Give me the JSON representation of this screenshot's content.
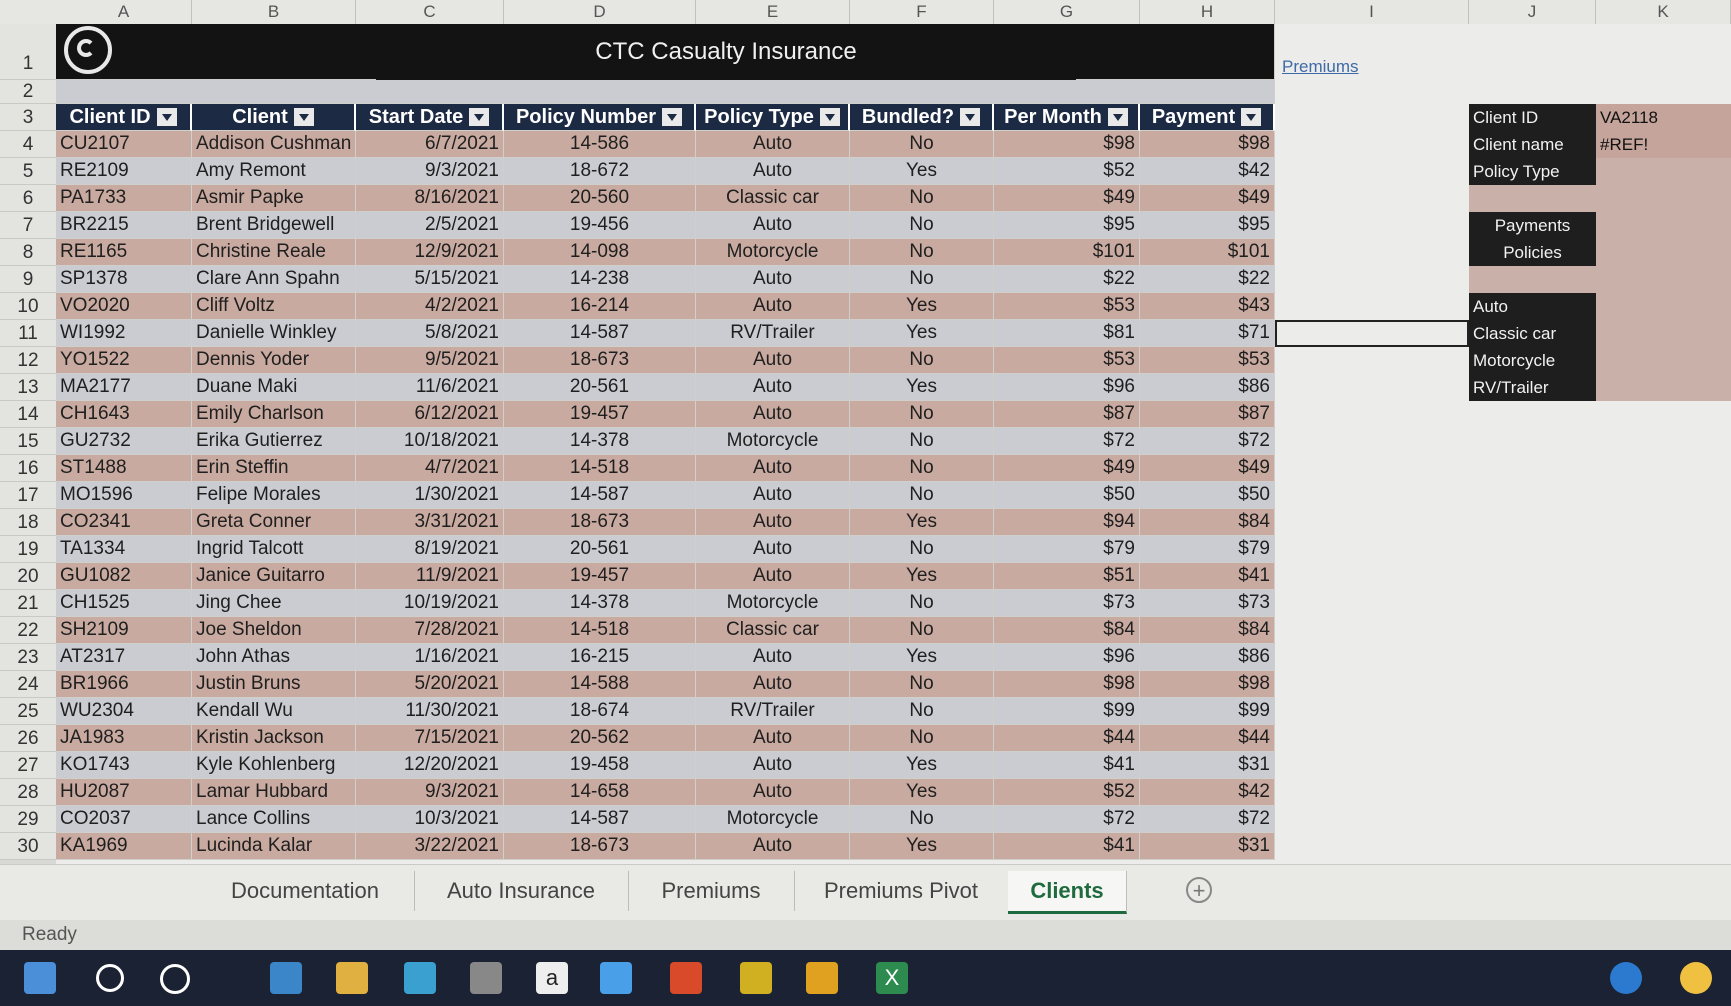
{
  "columns": [
    "A",
    "B",
    "C",
    "D",
    "E",
    "F",
    "G",
    "H",
    "I",
    "J",
    "K"
  ],
  "row_numbers": [
    "1",
    "2",
    "3",
    "4",
    "5",
    "6",
    "7",
    "8",
    "9",
    "10",
    "11",
    "12",
    "13",
    "14",
    "15",
    "16",
    "17",
    "18",
    "19",
    "20",
    "21",
    "22",
    "23",
    "24",
    "25",
    "26",
    "27",
    "28",
    "29",
    "30"
  ],
  "title": "CTC Casualty Insurance",
  "premiums_link": "Premiums",
  "headers": [
    "Client ID",
    "Client",
    "Start Date",
    "Policy Number",
    "Policy Type",
    "Bundled?",
    "Per Month",
    "Payment"
  ],
  "rows": [
    [
      "CU2107",
      "Addison Cushman",
      "6/7/2021",
      "14-586",
      "Auto",
      "No",
      "$98",
      "$98"
    ],
    [
      "RE2109",
      "Amy Remont",
      "9/3/2021",
      "18-672",
      "Auto",
      "Yes",
      "$52",
      "$42"
    ],
    [
      "PA1733",
      "Asmir Papke",
      "8/16/2021",
      "20-560",
      "Classic car",
      "No",
      "$49",
      "$49"
    ],
    [
      "BR2215",
      "Brent Bridgewell",
      "2/5/2021",
      "19-456",
      "Auto",
      "No",
      "$95",
      "$95"
    ],
    [
      "RE1165",
      "Christine Reale",
      "12/9/2021",
      "14-098",
      "Motorcycle",
      "No",
      "$101",
      "$101"
    ],
    [
      "SP1378",
      "Clare Ann Spahn",
      "5/15/2021",
      "14-238",
      "Auto",
      "No",
      "$22",
      "$22"
    ],
    [
      "VO2020",
      "Cliff Voltz",
      "4/2/2021",
      "16-214",
      "Auto",
      "Yes",
      "$53",
      "$43"
    ],
    [
      "WI1992",
      "Danielle Winkley",
      "5/8/2021",
      "14-587",
      "RV/Trailer",
      "Yes",
      "$81",
      "$71"
    ],
    [
      "YO1522",
      "Dennis Yoder",
      "9/5/2021",
      "18-673",
      "Auto",
      "No",
      "$53",
      "$53"
    ],
    [
      "MA2177",
      "Duane Maki",
      "11/6/2021",
      "20-561",
      "Auto",
      "Yes",
      "$96",
      "$86"
    ],
    [
      "CH1643",
      "Emily Charlson",
      "6/12/2021",
      "19-457",
      "Auto",
      "No",
      "$87",
      "$87"
    ],
    [
      "GU2732",
      "Erika Gutierrez",
      "10/18/2021",
      "14-378",
      "Motorcycle",
      "No",
      "$72",
      "$72"
    ],
    [
      "ST1488",
      "Erin Steffin",
      "4/7/2021",
      "14-518",
      "Auto",
      "No",
      "$49",
      "$49"
    ],
    [
      "MO1596",
      "Felipe Morales",
      "1/30/2021",
      "14-587",
      "Auto",
      "No",
      "$50",
      "$50"
    ],
    [
      "CO2341",
      "Greta Conner",
      "3/31/2021",
      "18-673",
      "Auto",
      "Yes",
      "$94",
      "$84"
    ],
    [
      "TA1334",
      "Ingrid Talcott",
      "8/19/2021",
      "20-561",
      "Auto",
      "No",
      "$79",
      "$79"
    ],
    [
      "GU1082",
      "Janice Guitarro",
      "11/9/2021",
      "19-457",
      "Auto",
      "Yes",
      "$51",
      "$41"
    ],
    [
      "CH1525",
      "Jing Chee",
      "10/19/2021",
      "14-378",
      "Motorcycle",
      "No",
      "$73",
      "$73"
    ],
    [
      "SH2109",
      "Joe Sheldon",
      "7/28/2021",
      "14-518",
      "Classic car",
      "No",
      "$84",
      "$84"
    ],
    [
      "AT2317",
      "John Athas",
      "1/16/2021",
      "16-215",
      "Auto",
      "Yes",
      "$96",
      "$86"
    ],
    [
      "BR1966",
      "Justin Bruns",
      "5/20/2021",
      "14-588",
      "Auto",
      "No",
      "$98",
      "$98"
    ],
    [
      "WU2304",
      "Kendall Wu",
      "11/30/2021",
      "18-674",
      "RV/Trailer",
      "No",
      "$99",
      "$99"
    ],
    [
      "JA1983",
      "Kristin Jackson",
      "7/15/2021",
      "20-562",
      "Auto",
      "No",
      "$44",
      "$44"
    ],
    [
      "KO1743",
      "Kyle Kohlenberg",
      "12/20/2021",
      "19-458",
      "Auto",
      "Yes",
      "$41",
      "$31"
    ],
    [
      "HU2087",
      "Lamar Hubbard",
      "9/3/2021",
      "14-658",
      "Auto",
      "Yes",
      "$52",
      "$42"
    ],
    [
      "CO2037",
      "Lance Collins",
      "10/3/2021",
      "14-587",
      "Motorcycle",
      "No",
      "$72",
      "$72"
    ],
    [
      "KA1969",
      "Lucinda Kalar",
      "3/22/2021",
      "18-673",
      "Auto",
      "Yes",
      "$41",
      "$31"
    ]
  ],
  "lookup": {
    "client_id_label": "Client ID",
    "client_id_value": "VA2118",
    "client_name_label": "Client name",
    "client_name_value": "#REF!",
    "policy_type_label": "Policy Type",
    "payments_label": "Payments",
    "policies_label": "Policies",
    "types": [
      "Auto",
      "Classic car",
      "Motorcycle",
      "RV/Trailer"
    ]
  },
  "tabs": [
    "Documentation",
    "Auto Insurance",
    "Premiums",
    "Premiums Pivot",
    "Clients"
  ],
  "active_tab": "Clients",
  "add_tab_symbol": "+",
  "status": "Ready",
  "taskbar_icons": [
    "windows-start-icon",
    "search-icon",
    "cortana-icon",
    "mail-icon",
    "file-explorer-icon",
    "file-icon",
    "store-icon",
    "amazon-icon",
    "dropbox-icon",
    "office-icon",
    "winamp-icon",
    "chrome-icon",
    "excel-icon",
    "help-icon",
    "weather-icon"
  ],
  "taskbar_amazon_label": "a",
  "taskbar_excel_label": "X"
}
